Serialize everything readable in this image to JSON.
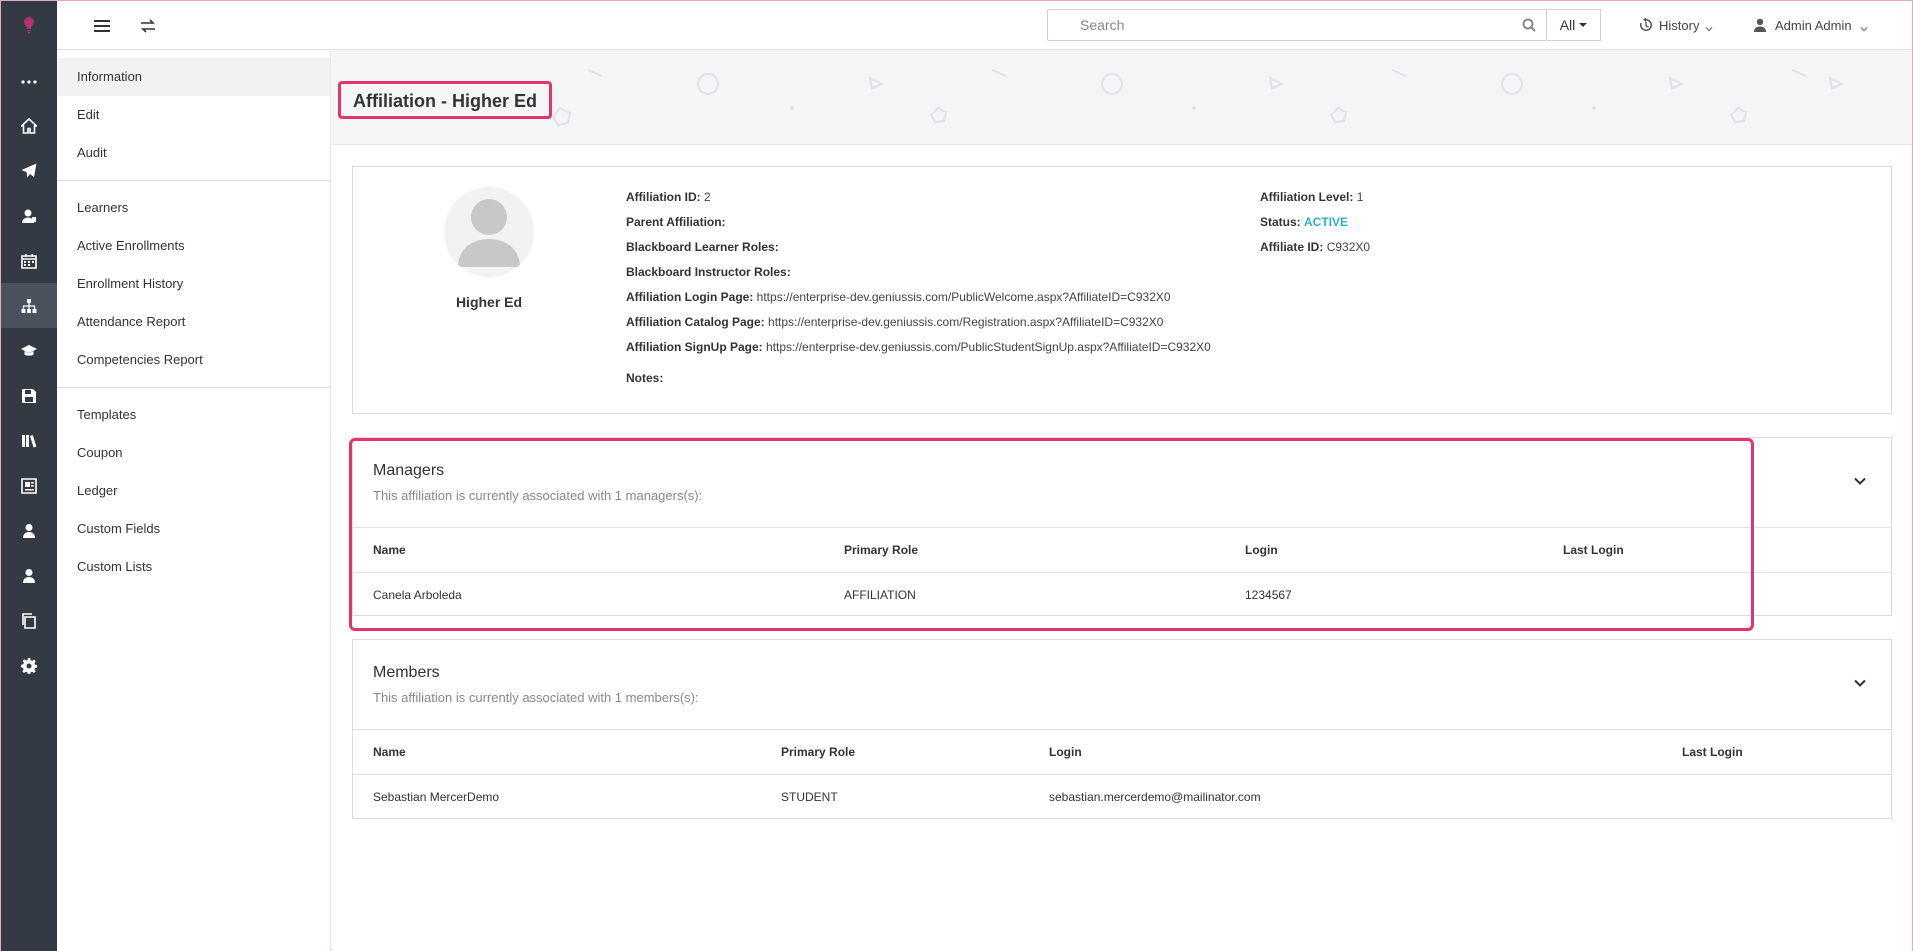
{
  "topbar": {
    "search_placeholder": "Search",
    "scope": "All",
    "history": "History",
    "user": "Admin Admin"
  },
  "subnav": {
    "group1": [
      "Information",
      "Edit",
      "Audit"
    ],
    "group2": [
      "Learners",
      "Active Enrollments",
      "Enrollment History",
      "Attendance Report",
      "Competencies Report"
    ],
    "group3": [
      "Templates",
      "Coupon",
      "Ledger",
      "Custom Fields",
      "Custom Lists"
    ],
    "active": "Information"
  },
  "page": {
    "title": "Affiliation - Higher Ed"
  },
  "info": {
    "name": "Higher Ed",
    "affiliation_id_label": "Affiliation ID:",
    "affiliation_id": "2",
    "parent_label": "Parent Affiliation:",
    "parent": "",
    "bb_learner_label": "Blackboard Learner Roles:",
    "bb_learner": "",
    "bb_instructor_label": "Blackboard Instructor Roles:",
    "bb_instructor": "",
    "login_page_label": "Affiliation Login Page:",
    "login_page": "https://enterprise-dev.geniussis.com/PublicWelcome.aspx?AffiliateID=C932X0",
    "catalog_page_label": "Affiliation Catalog Page:",
    "catalog_page": "https://enterprise-dev.geniussis.com/Registration.aspx?AffiliateID=C932X0",
    "signup_page_label": "Affiliation SignUp Page:",
    "signup_page": "https://enterprise-dev.geniussis.com/PublicStudentSignUp.aspx?AffiliateID=C932X0",
    "notes_label": "Notes:",
    "notes": "",
    "level_label": "Affiliation Level:",
    "level": "1",
    "status_label": "Status:",
    "status": "ACTIVE",
    "affiliate_id_label": "Affiliate ID:",
    "affiliate_id": "C932X0"
  },
  "managers": {
    "title": "Managers",
    "subtitle": "This affiliation is currently associated with 1 managers(s):",
    "columns": [
      "Name",
      "Primary Role",
      "Login",
      "Last Login"
    ],
    "rows": [
      [
        "Canela Arboleda",
        "AFFILIATION",
        "1234567",
        ""
      ]
    ]
  },
  "members": {
    "title": "Members",
    "subtitle": "This affiliation is currently associated with 1 members(s):",
    "columns": [
      "Name",
      "Primary Role",
      "Login",
      "Last Login"
    ],
    "rows": [
      [
        "Sebastian MercerDemo",
        "STUDENT",
        "sebastian.mercerdemo@mailinator.com",
        ""
      ]
    ]
  },
  "colors": {
    "accent": "#e5336b",
    "rail": "#343a44",
    "status_active": "#2bb3c5"
  },
  "icons": {
    "rail": [
      "logo-icon",
      "more-icon",
      "home-icon",
      "paper-plane-icon",
      "user-graduate-icon",
      "calendar-icon",
      "sitemap-icon",
      "graduation-cap-icon",
      "save-icon",
      "books-icon",
      "report-icon",
      "user-tie-icon",
      "user-tie-icon",
      "copy-icon",
      "gear-icon"
    ]
  }
}
